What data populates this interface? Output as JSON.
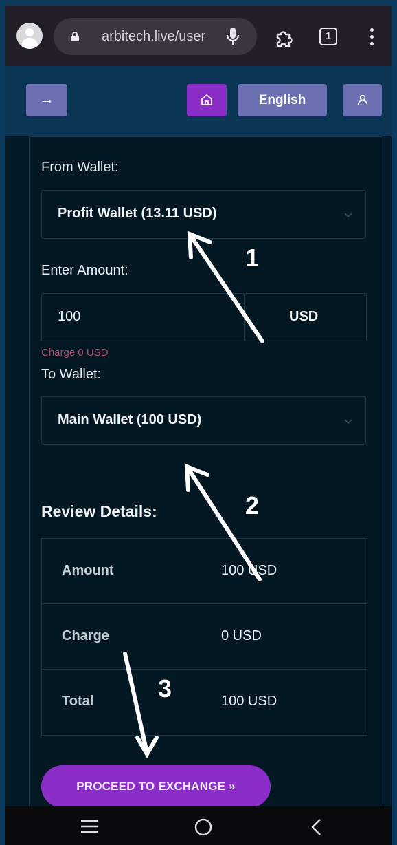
{
  "browser": {
    "url": "arbitech.live/user",
    "tab_count": "1",
    "icons": [
      "avatar-icon",
      "lock-icon",
      "mic-icon",
      "extensions-icon",
      "tabs-icon",
      "menu-icon"
    ]
  },
  "header": {
    "arrow_icon": "→",
    "language_label": "English"
  },
  "form": {
    "from_wallet_label": "From Wallet:",
    "from_wallet_value": "Profit Wallet (13.11 USD)",
    "amount_label": "Enter Amount:",
    "amount_value": "100",
    "amount_currency": "USD",
    "charge_note": "Charge 0 USD",
    "to_wallet_label": "To Wallet:",
    "to_wallet_value": "Main Wallet (100 USD)"
  },
  "review": {
    "title": "Review Details:",
    "rows": [
      {
        "key": "Amount",
        "value": "100 USD"
      },
      {
        "key": "Charge",
        "value": "0 USD"
      },
      {
        "key": "Total",
        "value": "100 USD"
      }
    ]
  },
  "actions": {
    "proceed_label": "PROCEED TO EXCHANGE »"
  },
  "annotations": {
    "steps": [
      "1",
      "2",
      "3"
    ]
  },
  "colors": {
    "accent_purple": "#8a2ec7",
    "button_slate": "#6b70b3",
    "panel_bg": "#041a28",
    "charge_note": "#b04a6a"
  }
}
